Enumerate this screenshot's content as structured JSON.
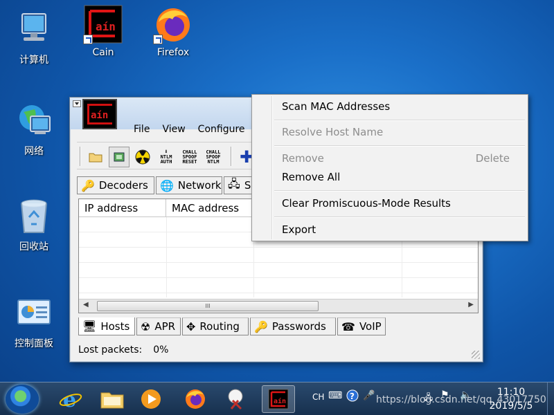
{
  "desktop": {
    "icons": [
      {
        "label": "计算机",
        "icon": "computer-icon"
      },
      {
        "label": "Cain",
        "icon": "cain-icon"
      },
      {
        "label": "Firefox",
        "icon": "firefox-icon"
      },
      {
        "label": "网络",
        "icon": "network-icon"
      },
      {
        "label": "回收站",
        "icon": "recycle-bin-icon"
      },
      {
        "label": "控制面板",
        "icon": "control-panel-icon"
      }
    ]
  },
  "window": {
    "logo_text": "aín",
    "menu": [
      "File",
      "View",
      "Configure"
    ],
    "toolbar": {
      "ntlm_auth": [
        "NTLM",
        "AUTH"
      ],
      "chall_spoof_reset": [
        "CHALL",
        "SPOOF",
        "RESET"
      ],
      "chall_spoof_ntlm": [
        "CHALL",
        "SPOOF",
        "NTLM"
      ]
    },
    "top_tabs": [
      "Decoders",
      "Network",
      "S"
    ],
    "columns": [
      "IP address",
      "MAC address"
    ],
    "scroll_grip": "III",
    "bottom_tabs": [
      "Hosts",
      "APR",
      "Routing",
      "Passwords",
      "VoIP"
    ],
    "status": {
      "label": "Lost packets:",
      "value": "0%"
    }
  },
  "context_menu": {
    "items": [
      {
        "label": "Scan MAC Addresses",
        "enabled": true
      },
      {
        "label": "Resolve Host Name",
        "enabled": false
      },
      {
        "label": "Remove",
        "shortcut": "Delete",
        "enabled": false
      },
      {
        "label": "Remove All",
        "enabled": true
      },
      {
        "label": "Clear Promiscuous-Mode Results",
        "enabled": true
      },
      {
        "label": "Export",
        "enabled": true
      }
    ]
  },
  "taskbar": {
    "tray": {
      "lang": "CH"
    },
    "clock": {
      "time": "11:10",
      "date": "2019/5/5"
    },
    "watermark": "https://blog.csdn.net/qq_43017750"
  },
  "colors": {
    "desktop": "#1a6fc8",
    "taskbar": "#17304e",
    "disabled_text": "#8d8d8d"
  }
}
